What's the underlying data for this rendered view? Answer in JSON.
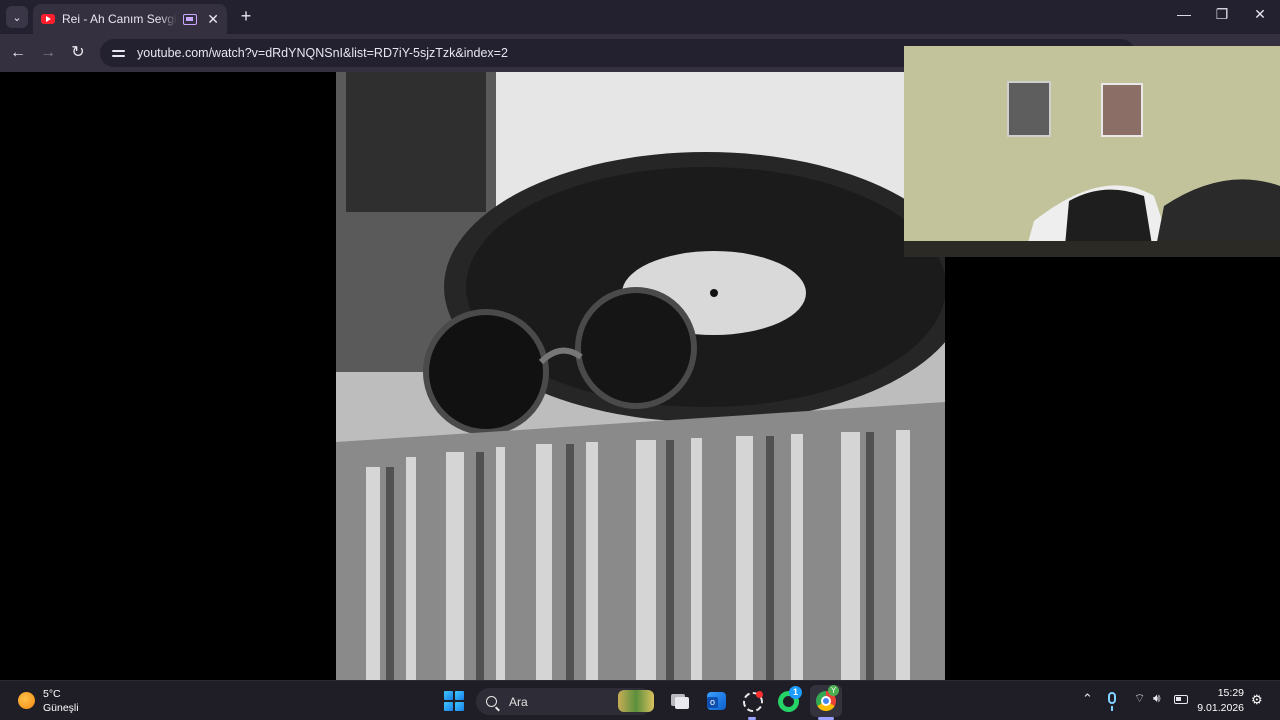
{
  "browser": {
    "tab_title": "Rei - Ah Canım Sevgilim - YouTube",
    "url": "youtube.com/watch?v=dRdYNQNSnI&list=RD7iY-5sjzTzk&index=2"
  },
  "taskbar": {
    "weather_temp": "5°C",
    "weather_condition": "Güneşli",
    "search_placeholder": "Ara",
    "whatsapp_badge": "1",
    "time": "15:29",
    "date": "9.01.2026"
  },
  "icons": {
    "tab_search": "chevron-down",
    "back": "arrow-left",
    "forward": "arrow-right",
    "reload": "reload",
    "site_info": "tune",
    "start": "windows-logo"
  },
  "colors": {
    "tabstrip": "#23202f",
    "toolbar": "#35303f",
    "taskbar": "#1f1d26",
    "accent": "#9aa0ff"
  }
}
